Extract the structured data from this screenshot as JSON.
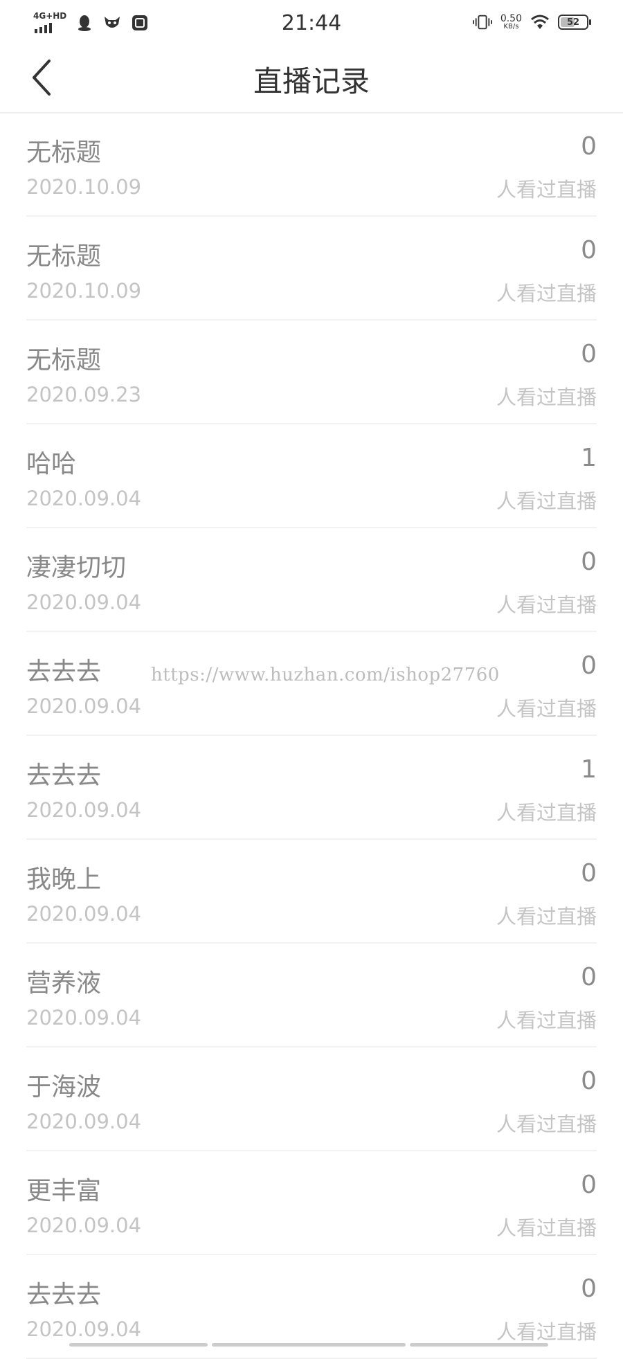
{
  "status_bar": {
    "network": "4G+HD",
    "time": "21:44",
    "speed_value": "0.50",
    "speed_unit": "KB/s",
    "battery": "52"
  },
  "header": {
    "title": "直播记录"
  },
  "records": [
    {
      "title": "无标题",
      "date": "2020.10.09",
      "count": "0",
      "label": "人看过直播"
    },
    {
      "title": "无标题",
      "date": "2020.10.09",
      "count": "0",
      "label": "人看过直播"
    },
    {
      "title": "无标题",
      "date": "2020.09.23",
      "count": "0",
      "label": "人看过直播"
    },
    {
      "title": "哈哈",
      "date": "2020.09.04",
      "count": "1",
      "label": "人看过直播"
    },
    {
      "title": "凄凄切切",
      "date": "2020.09.04",
      "count": "0",
      "label": "人看过直播"
    },
    {
      "title": "去去去",
      "date": "2020.09.04",
      "count": "0",
      "label": "人看过直播"
    },
    {
      "title": "去去去",
      "date": "2020.09.04",
      "count": "1",
      "label": "人看过直播"
    },
    {
      "title": "我晚上",
      "date": "2020.09.04",
      "count": "0",
      "label": "人看过直播"
    },
    {
      "title": "营养液",
      "date": "2020.09.04",
      "count": "0",
      "label": "人看过直播"
    },
    {
      "title": "于海波",
      "date": "2020.09.04",
      "count": "0",
      "label": "人看过直播"
    },
    {
      "title": "更丰富",
      "date": "2020.09.04",
      "count": "0",
      "label": "人看过直播"
    },
    {
      "title": "去去去",
      "date": "2020.09.04",
      "count": "0",
      "label": "人看过直播"
    }
  ],
  "watermark": "https://www.huzhan.com/ishop27760",
  "icons": {
    "back": "chevron-left-icon",
    "status_apps": [
      "qq-icon",
      "app-icon",
      "taobao-icon"
    ],
    "status_system": [
      "vibrate-icon",
      "wifi-icon",
      "battery-icon"
    ]
  }
}
